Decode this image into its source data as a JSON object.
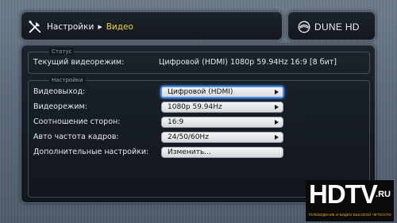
{
  "header": {
    "breadcrumb_home": "Настройки",
    "breadcrumb_current": "Видео",
    "current_color": "#f2d230"
  },
  "brand": {
    "name": "DUNE HD"
  },
  "status": {
    "legend": "Статус",
    "current_mode_label": "Текущий видеорежим:",
    "current_mode_value": "Цифровой (HDMI) 1080p 59.94Hz 16:9 [8 бит]"
  },
  "settings": {
    "legend": "Настройки",
    "rows": [
      {
        "label": "Видеовыход:",
        "value": "Цифровой (HDMI)",
        "has_arrow": true,
        "focused": true
      },
      {
        "label": "Видеорежим:",
        "value": "1080p 59.94Hz",
        "has_arrow": true,
        "focused": false
      },
      {
        "label": "Соотношение сторон:",
        "value": "16:9",
        "has_arrow": true,
        "focused": false
      },
      {
        "label": "Авто частота кадров:",
        "value": "24/50/60Hz",
        "has_arrow": true,
        "focused": false
      },
      {
        "label": "Дополнительные настройки:",
        "value": "Изменить...",
        "has_arrow": false,
        "focused": false
      }
    ]
  },
  "watermark": {
    "logo_text": "HDTV",
    "logo_suffix": ".RU",
    "tagline": "ТЕЛЕВИДЕНИЕ И ВИДЕО ВЫСОКОЙ ЧЕТКОСТИ"
  },
  "colors": {
    "focus": "#3d8df0",
    "accent": "#f2d230"
  }
}
